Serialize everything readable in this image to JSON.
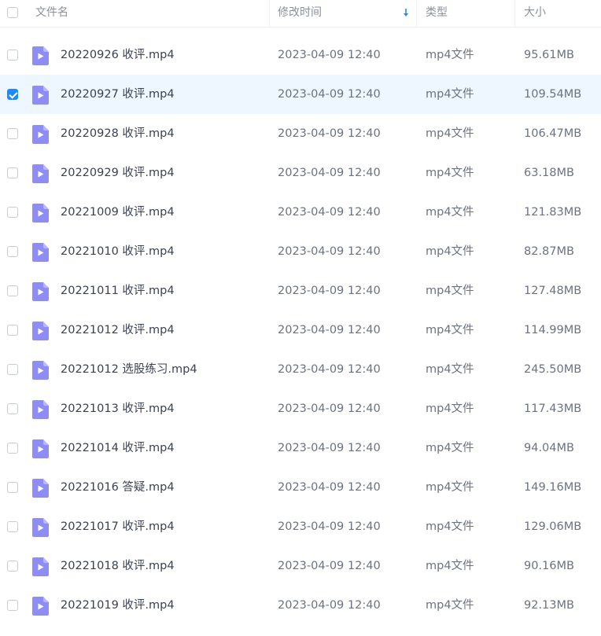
{
  "header": {
    "name": "文件名",
    "modified": "修改时间",
    "type": "类型",
    "size": "大小"
  },
  "colors": {
    "accent": "#1a8cff",
    "selected_row": "#eef6ff",
    "file_icon": "#8e8cf5"
  },
  "rows": [
    {
      "name": "20220926 收评.mp4",
      "modified": "2023-04-09 12:40",
      "type": "mp4文件",
      "size": "95.61MB",
      "selected": false
    },
    {
      "name": "20220927 收评.mp4",
      "modified": "2023-04-09 12:40",
      "type": "mp4文件",
      "size": "109.54MB",
      "selected": true
    },
    {
      "name": "20220928 收评.mp4",
      "modified": "2023-04-09 12:40",
      "type": "mp4文件",
      "size": "106.47MB",
      "selected": false
    },
    {
      "name": "20220929 收评.mp4",
      "modified": "2023-04-09 12:40",
      "type": "mp4文件",
      "size": "63.18MB",
      "selected": false
    },
    {
      "name": "20221009 收评.mp4",
      "modified": "2023-04-09 12:40",
      "type": "mp4文件",
      "size": "121.83MB",
      "selected": false
    },
    {
      "name": "20221010 收评.mp4",
      "modified": "2023-04-09 12:40",
      "type": "mp4文件",
      "size": "82.87MB",
      "selected": false
    },
    {
      "name": "20221011 收评.mp4",
      "modified": "2023-04-09 12:40",
      "type": "mp4文件",
      "size": "127.48MB",
      "selected": false
    },
    {
      "name": "20221012 收评.mp4",
      "modified": "2023-04-09 12:40",
      "type": "mp4文件",
      "size": "114.99MB",
      "selected": false
    },
    {
      "name": "20221012 选股练习.mp4",
      "modified": "2023-04-09 12:40",
      "type": "mp4文件",
      "size": "245.50MB",
      "selected": false
    },
    {
      "name": "20221013 收评.mp4",
      "modified": "2023-04-09 12:40",
      "type": "mp4文件",
      "size": "117.43MB",
      "selected": false
    },
    {
      "name": "20221014 收评.mp4",
      "modified": "2023-04-09 12:40",
      "type": "mp4文件",
      "size": "94.04MB",
      "selected": false
    },
    {
      "name": "20221016 答疑.mp4",
      "modified": "2023-04-09 12:40",
      "type": "mp4文件",
      "size": "149.16MB",
      "selected": false
    },
    {
      "name": "20221017 收评.mp4",
      "modified": "2023-04-09 12:40",
      "type": "mp4文件",
      "size": "129.06MB",
      "selected": false
    },
    {
      "name": "20221018 收评.mp4",
      "modified": "2023-04-09 12:40",
      "type": "mp4文件",
      "size": "90.16MB",
      "selected": false
    },
    {
      "name": "20221019 收评.mp4",
      "modified": "2023-04-09 12:40",
      "type": "mp4文件",
      "size": "92.13MB",
      "selected": false
    }
  ]
}
